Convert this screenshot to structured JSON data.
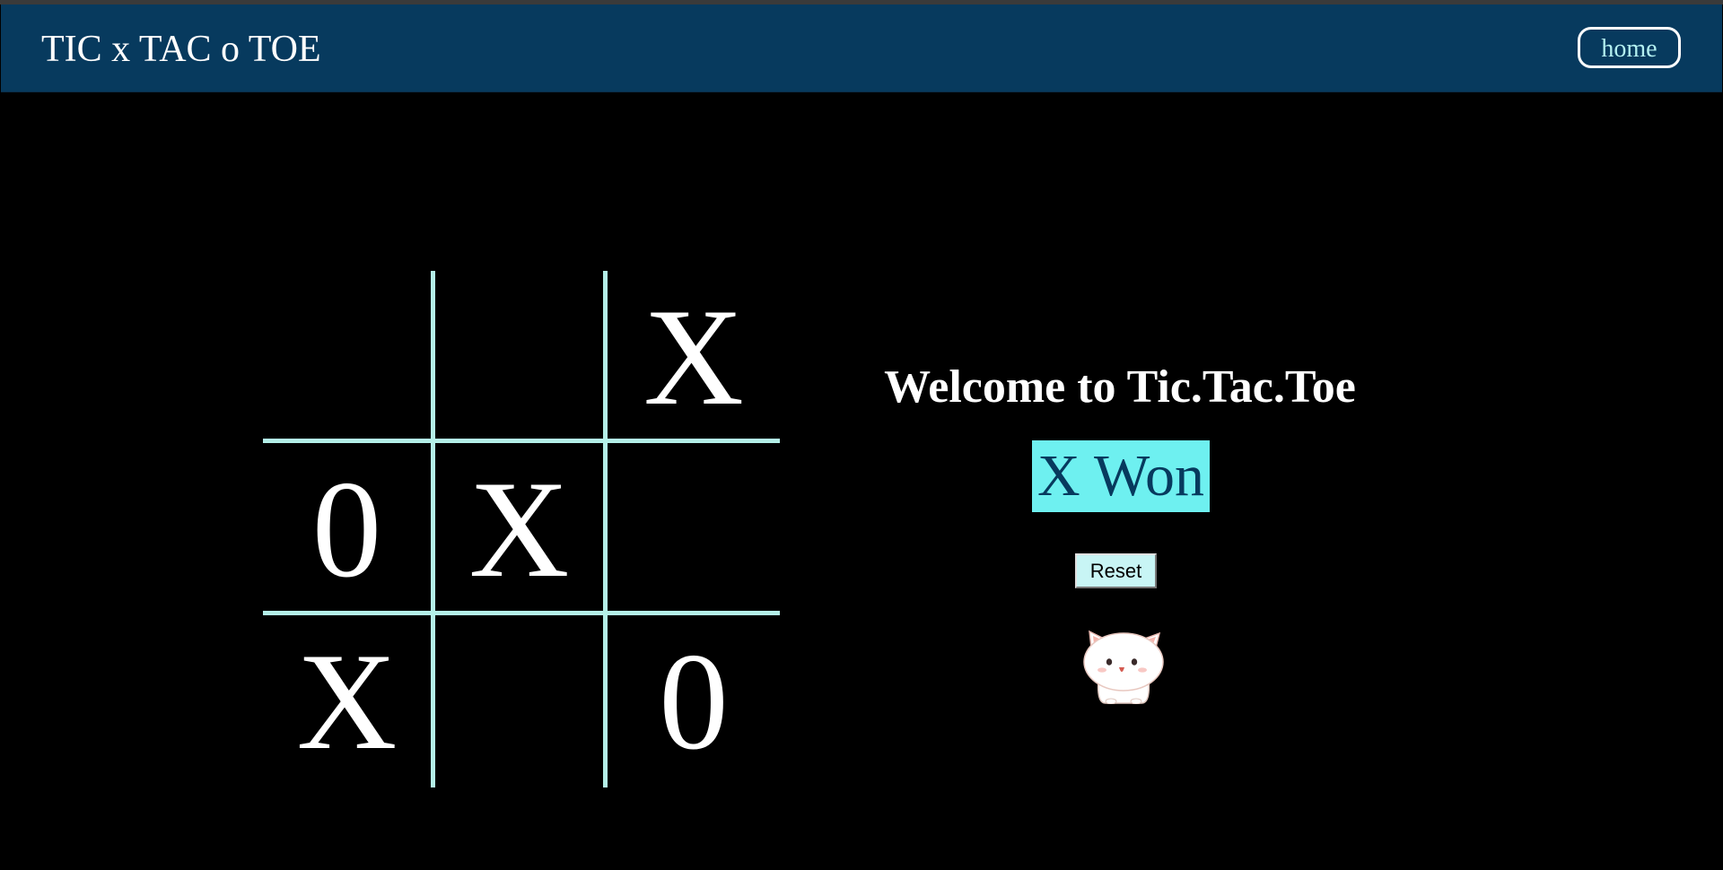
{
  "header": {
    "brand": "TIC x TAC o TOE",
    "home_label": "home"
  },
  "board": {
    "cells": [
      "",
      "",
      "X",
      "0",
      "X",
      "",
      "X",
      "",
      "0"
    ]
  },
  "panel": {
    "welcome": "Welcome to Tic.Tac.Toe",
    "status": "X Won",
    "reset_label": "Reset",
    "mascot_icon": "cat-mascot-icon"
  },
  "colors": {
    "navbar": "#073a5e",
    "board_lines": "#b4f0e8",
    "status_bg": "#6ef0f0",
    "status_text": "#073a5e",
    "home_text": "#b4f0f0",
    "reset_bg": "#c8f5f5"
  }
}
